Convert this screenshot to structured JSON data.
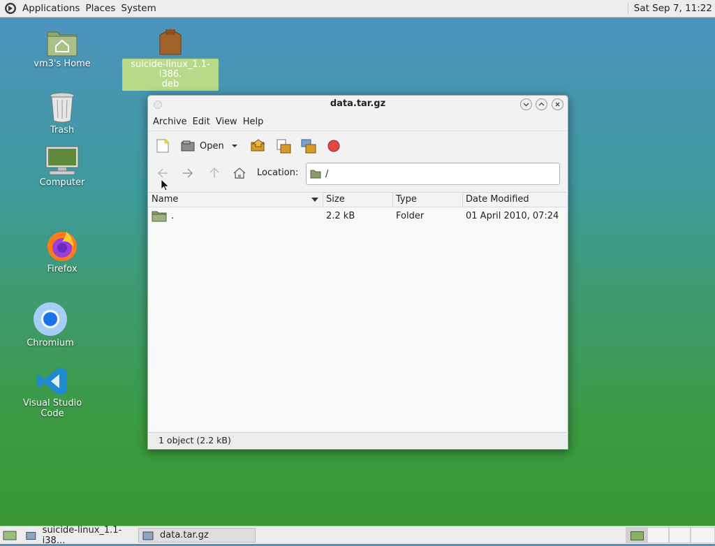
{
  "top_panel": {
    "menus": [
      "Applications",
      "Places",
      "System"
    ],
    "clock": "Sat Sep  7, 11:22"
  },
  "desktop": {
    "icons": [
      {
        "label": "vm3's Home"
      },
      {
        "label": "Trash"
      },
      {
        "label": "Computer"
      },
      {
        "label": "Firefox"
      },
      {
        "label": "Chromium"
      },
      {
        "label": "Visual Studio Code"
      },
      {
        "label_line1": "suicide-linux_1.1-i386.",
        "label_line2": "deb"
      }
    ]
  },
  "window": {
    "title": "data.tar.gz",
    "menus": [
      "Archive",
      "Edit",
      "View",
      "Help"
    ],
    "toolbar": {
      "open_label": "Open"
    },
    "location": {
      "label": "Location:",
      "value": "/"
    },
    "columns": [
      "Name",
      "Size",
      "Type",
      "Date Modified"
    ],
    "rows": [
      {
        "name": ".",
        "size": "2.2 kB",
        "type": "Folder",
        "modified": "01 April 2010, 07:24"
      }
    ],
    "status": "1 object (2.2 kB)"
  },
  "taskbar": {
    "tasks": [
      "suicide-linux_1.1-i38...",
      "data.tar.gz"
    ]
  },
  "colors": {
    "desktop_top": "#4f93c2",
    "desktop_bottom": "#38952f",
    "selection": "#b9d98a"
  }
}
